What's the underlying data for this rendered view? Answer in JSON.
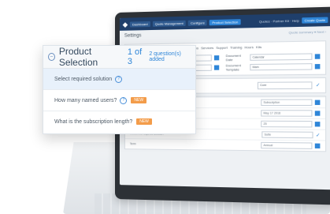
{
  "app": {
    "logo": "◆",
    "tabs": [
      "Dashboard",
      "Quote Management",
      "Configure",
      "Product Selection"
    ],
    "top_links": "Quotes · Partner Kit · Help",
    "top_button": "Create Quote",
    "page_title": "Settings",
    "page_title_right": "Quote summary ▾   Next ›"
  },
  "screen_filters": [
    "All",
    "Licenses",
    "Suites",
    "SaaS",
    "Products",
    "Add-ons",
    "Services",
    "Support",
    "Training",
    "Hours",
    "Kits"
  ],
  "screen_fields": [
    {
      "label": "Account Site",
      "value": "May 17 2016"
    },
    {
      "label": "Document Date",
      "value": "Calendar"
    },
    {
      "label": "Contract Currency",
      "value": "USD"
    },
    {
      "label": "Document Template",
      "value": "Main"
    }
  ],
  "screen_row": {
    "label": "Select product",
    "value": "Core"
  },
  "screen_list": [
    {
      "label": "Licensing model",
      "value": "Subscription"
    },
    {
      "label": "Start date",
      "value": "May 17 2016"
    },
    {
      "label": "How many named users will you need?",
      "value": "25"
    },
    {
      "label": "Select the required solution",
      "value": "Suite"
    },
    {
      "label": "Term",
      "value": "Annual"
    }
  ],
  "panel": {
    "title": "Product Selection",
    "progress": "1 of 3",
    "count": "2 question(s) added",
    "questions": [
      {
        "text": "Select required solution",
        "new_label": ""
      },
      {
        "text": "How many named users?",
        "new_label": "NEW"
      },
      {
        "text": "What is the subscription length?",
        "new_label": "NEW"
      }
    ]
  }
}
